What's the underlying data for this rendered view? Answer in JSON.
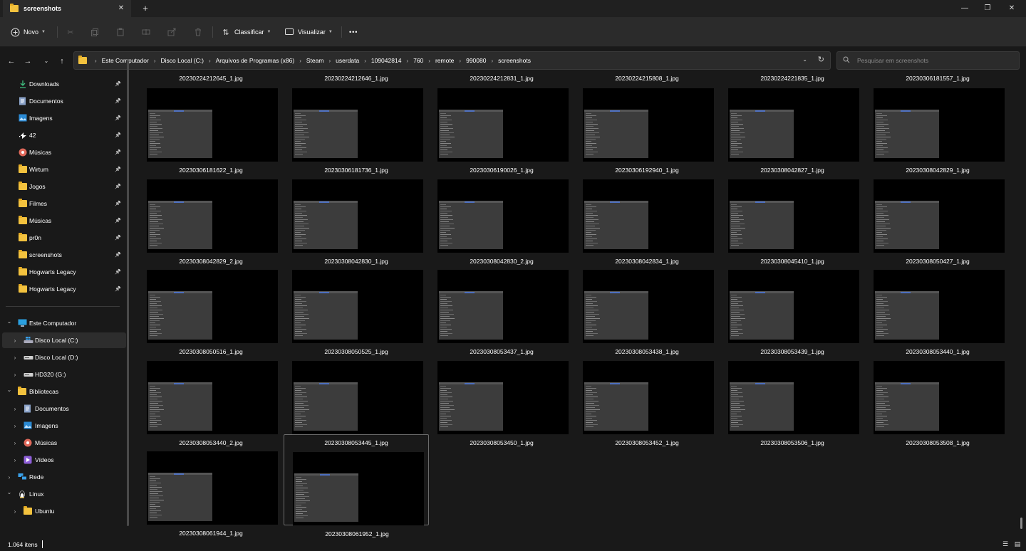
{
  "window": {
    "tab_title": "screenshots",
    "tab_close": "✕",
    "new_tab": "+",
    "minimize": "—",
    "maximize": "❐",
    "close": "✕"
  },
  "toolbar": {
    "new_label": "Novo",
    "sort_label": "Classificar",
    "view_label": "Visualizar",
    "more_label": "•••"
  },
  "address": {
    "crumbs": [
      "Este Computador",
      "Disco Local (C:)",
      "Arquivos de Programas (x86)",
      "Steam",
      "userdata",
      "109042814",
      "760",
      "remote",
      "990080",
      "screenshots"
    ]
  },
  "search": {
    "placeholder": "Pesquisar em screenshots"
  },
  "sidebar": {
    "quick_access": [
      {
        "label": "Downloads",
        "icon": "download-icon"
      },
      {
        "label": "Documentos",
        "icon": "document-icon"
      },
      {
        "label": "Imagens",
        "icon": "pictures-icon"
      },
      {
        "label": "42",
        "icon": "app-42-icon"
      },
      {
        "label": "Músicas",
        "icon": "music-icon"
      },
      {
        "label": "Wirtum",
        "icon": "folder-icon"
      },
      {
        "label": "Jogos",
        "icon": "folder-icon"
      },
      {
        "label": "Filmes",
        "icon": "folder-icon"
      },
      {
        "label": "Músicas",
        "icon": "folder-icon"
      },
      {
        "label": "pr0n",
        "icon": "folder-icon"
      },
      {
        "label": "screenshots",
        "icon": "folder-icon"
      },
      {
        "label": "Hogwarts Legacy",
        "icon": "folder-icon"
      },
      {
        "label": "Hogwarts Legacy",
        "icon": "folder-icon"
      }
    ],
    "tree": [
      {
        "label": "Este Computador",
        "level": 0,
        "expanded": true,
        "icon": "computer-icon"
      },
      {
        "label": "Disco Local (C:)",
        "level": 1,
        "expanded": false,
        "icon": "drive-windows-icon",
        "selected": true
      },
      {
        "label": "Disco Local (D:)",
        "level": 1,
        "expanded": false,
        "icon": "drive-icon"
      },
      {
        "label": "HD320 (G:)",
        "level": 1,
        "expanded": false,
        "icon": "drive-icon"
      },
      {
        "label": "Bibliotecas",
        "level": 0,
        "expanded": true,
        "icon": "folder-icon"
      },
      {
        "label": "Documentos",
        "level": 1,
        "expanded": false,
        "icon": "document-icon"
      },
      {
        "label": "Imagens",
        "level": 1,
        "expanded": false,
        "icon": "pictures-icon"
      },
      {
        "label": "Músicas",
        "level": 1,
        "expanded": false,
        "icon": "music-icon"
      },
      {
        "label": "Vídeos",
        "level": 1,
        "expanded": false,
        "icon": "video-icon"
      },
      {
        "label": "Rede",
        "level": 0,
        "expanded": false,
        "icon": "network-icon"
      },
      {
        "label": "Linux",
        "level": 0,
        "expanded": true,
        "icon": "linux-icon"
      },
      {
        "label": "Ubuntu",
        "level": 1,
        "expanded": false,
        "icon": "folder-icon"
      }
    ]
  },
  "files": {
    "header_row": [
      "20230224212645_1.jpg",
      "20230224212646_1.jpg",
      "20230224212831_1.jpg",
      "20230224215808_1.jpg",
      "20230224221835_1.jpg",
      "20230306181557_1.jpg"
    ],
    "items": [
      "20230306181622_1.jpg",
      "20230306181736_1.jpg",
      "20230306190026_1.jpg",
      "20230306192940_1.jpg",
      "20230308042827_1.jpg",
      "20230308042829_1.jpg",
      "20230308042829_2.jpg",
      "20230308042830_1.jpg",
      "20230308042830_2.jpg",
      "20230308042834_1.jpg",
      "20230308045410_1.jpg",
      "20230308050427_1.jpg",
      "20230308050516_1.jpg",
      "20230308050525_1.jpg",
      "20230308053437_1.jpg",
      "20230308053438_1.jpg",
      "20230308053439_1.jpg",
      "20230308053440_1.jpg",
      "20230308053440_2.jpg",
      "20230308053445_1.jpg",
      "20230308053450_1.jpg",
      "20230308053452_1.jpg",
      "20230308053506_1.jpg",
      "20230308053508_1.jpg",
      "20230308061944_1.jpg",
      "20230308061952_1.jpg"
    ]
  },
  "status": {
    "count": "1.064 itens"
  },
  "colors": {
    "background": "#191919",
    "toolbar": "#2b2b2b",
    "folder": "#f3c23e",
    "accent": "#4d6fbf"
  }
}
